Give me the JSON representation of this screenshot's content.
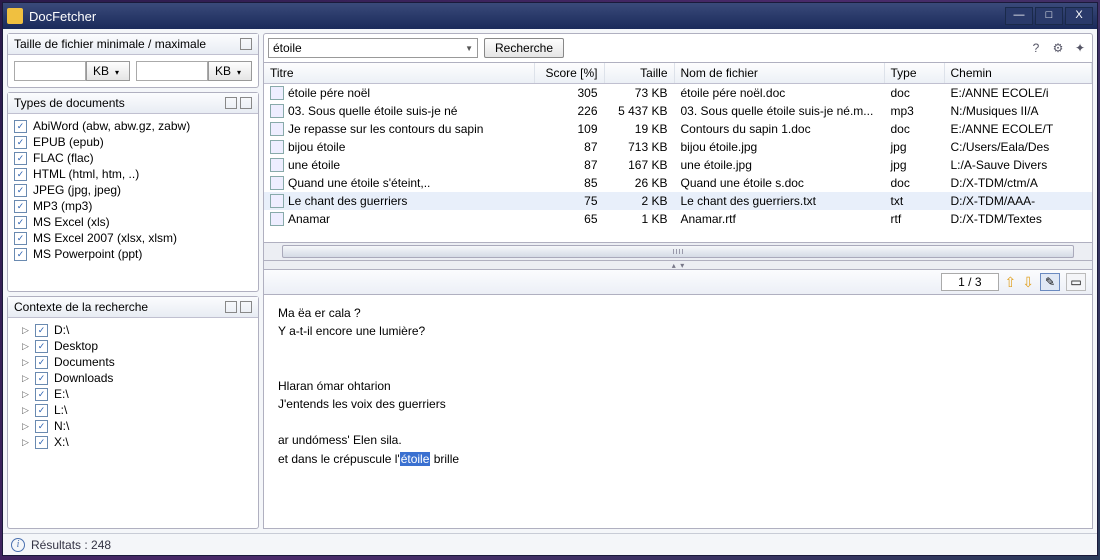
{
  "app": {
    "title": "DocFetcher"
  },
  "sidebar": {
    "filesize": {
      "heading": "Taille de fichier minimale / maximale",
      "unit": "KB"
    },
    "doctypes": {
      "heading": "Types de documents",
      "items": [
        "AbiWord (abw, abw.gz, zabw)",
        "EPUB (epub)",
        "FLAC (flac)",
        "HTML (html, htm, ..)",
        "JPEG (jpg, jpeg)",
        "MP3 (mp3)",
        "MS Excel (xls)",
        "MS Excel 2007 (xlsx, xlsm)",
        "MS Powerpoint (ppt)"
      ]
    },
    "context": {
      "heading": "Contexte de la recherche",
      "items": [
        "D:\\",
        "Desktop",
        "Documents",
        "Downloads",
        "E:\\",
        "L:\\",
        "N:\\",
        "X:\\"
      ]
    }
  },
  "search": {
    "query": "étoile",
    "button": "Recherche"
  },
  "results": {
    "columns": {
      "title": "Titre",
      "score": "Score [%]",
      "size": "Taille",
      "filename": "Nom de fichier",
      "type": "Type",
      "path": "Chemin"
    },
    "rows": [
      {
        "title": "étoile pére noël",
        "score": "305",
        "size": "73 KB",
        "filename": "étoile pére noël.doc",
        "type": "doc",
        "path": "E:/ANNE ECOLE/i"
      },
      {
        "title": "03. Sous quelle étoile suis-je né",
        "score": "226",
        "size": "5 437 KB",
        "filename": "03. Sous quelle étoile suis-je né.m...",
        "type": "mp3",
        "path": "N:/Musiques II/A"
      },
      {
        "title": "Je repasse sur les contours du sapin",
        "score": "109",
        "size": "19 KB",
        "filename": "Contours du sapin 1.doc",
        "type": "doc",
        "path": "E:/ANNE ECOLE/T"
      },
      {
        "title": "bijou étoile",
        "score": "87",
        "size": "713 KB",
        "filename": "bijou étoile.jpg",
        "type": "jpg",
        "path": "C:/Users/Eala/Des"
      },
      {
        "title": "une étoile",
        "score": "87",
        "size": "167 KB",
        "filename": "une étoile.jpg",
        "type": "jpg",
        "path": "L:/A-Sauve Divers"
      },
      {
        "title": "Quand une étoile s'éteint,..",
        "score": "85",
        "size": "26 KB",
        "filename": "Quand une étoile s.doc",
        "type": "doc",
        "path": "D:/X-TDM/ctm/A"
      },
      {
        "title": "Le chant des guerriers",
        "score": "75",
        "size": "2 KB",
        "filename": "Le chant des guerriers.txt",
        "type": "txt",
        "path": "D:/X-TDM/AAA- ",
        "selected": true
      },
      {
        "title": "Anamar",
        "score": "65",
        "size": "1 KB",
        "filename": "Anamar.rtf",
        "type": "rtf",
        "path": "D:/X-TDM/Textes"
      }
    ]
  },
  "preview": {
    "page": "1 / 3",
    "lines_before": "Ma ëa er cala ?\nY a-t-il encore une lumière?\n\n\nHlaran ómar ohtarion\nJ'entends les voix des guerriers\n\nar undómess' Elen sila.\net dans le crépuscule l'",
    "highlight": "étoile",
    "after": " brille"
  },
  "status": {
    "text": "Résultats : 248"
  }
}
